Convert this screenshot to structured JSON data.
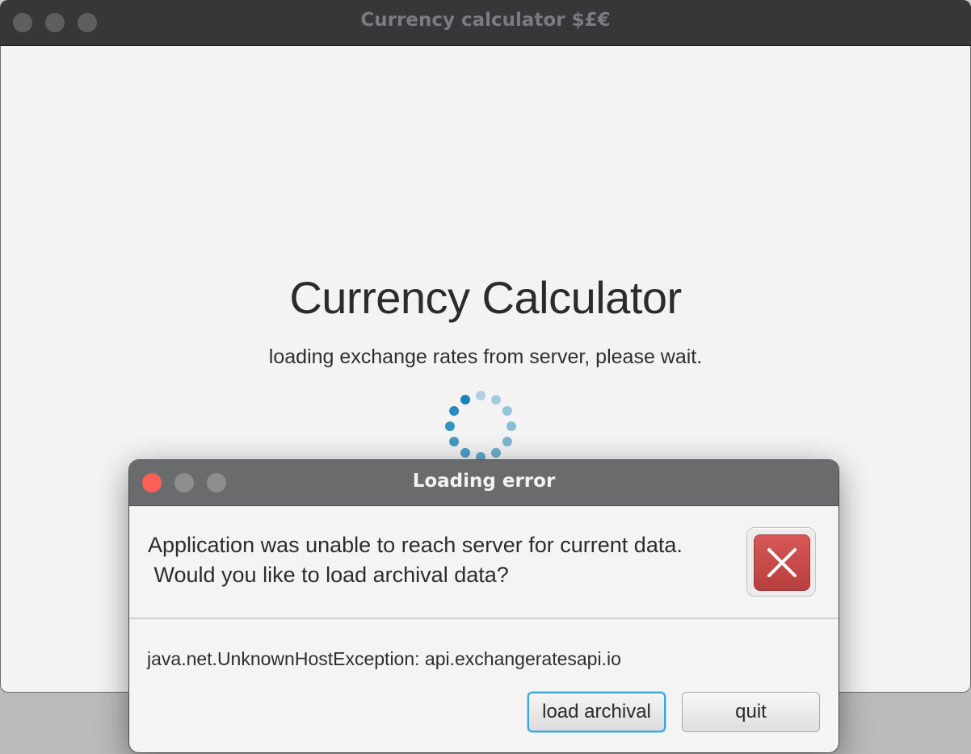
{
  "main_window": {
    "title": "Currency calculator $£€",
    "heading": "Currency Calculator",
    "loading_text": "loading exchange rates from server, please wait."
  },
  "dialog": {
    "title": "Loading error",
    "message_line1": "Application was unable to reach server for current data.",
    "message_line2": " Would you like to load archival data?",
    "detail": "java.net.UnknownHostException: api.exchangeratesapi.io",
    "buttons": {
      "load_archival": "load archival",
      "quit": "quit"
    }
  },
  "colors": {
    "close_red": "#fe5f57",
    "error_icon": "#c94c4c",
    "focus_blue": "#3aa6d8",
    "spinner_blue": "#1a84b8"
  }
}
